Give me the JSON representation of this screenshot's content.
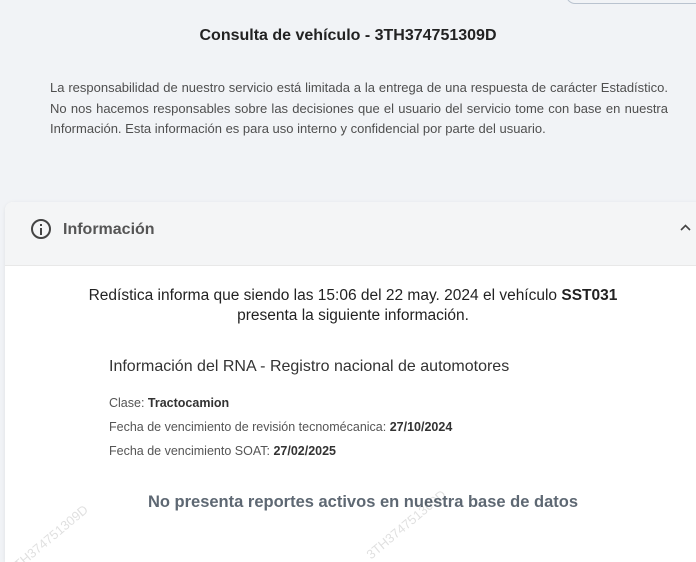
{
  "page": {
    "title": "Consulta de vehículo - 3TH374751309D",
    "disclaimer": "La responsabilidad de nuestro servicio está limitada a la entrega de una respuesta de carácter Estadístico. No nos hacemos responsables sobre las decisiones que el usuario del servicio tome con base en nuestra Información. Esta información es para uso interno y confidencial por parte del usuario."
  },
  "card": {
    "title": "Información",
    "icon": "info-icon",
    "collapse_icon": "chevron-up-icon",
    "lead_prefix": "Redística informa que siendo las 15:06 del 22 may. 2024 el vehículo",
    "plate": "SST031",
    "lead_suffix": "presenta la siguiente información.",
    "section_title": "Información del RNA - Registro nacional de automotores",
    "fields": [
      {
        "label": "Clase:",
        "value": "Tractocamion"
      },
      {
        "label": "Fecha de vencimiento de revisión tecnomécanica:",
        "value": "27/10/2024"
      },
      {
        "label": "Fecha de vencimiento SOAT:",
        "value": "27/02/2025"
      }
    ],
    "no_reports": "No presenta reportes activos en nuestra base de datos"
  },
  "watermark": "3TH374751309D"
}
